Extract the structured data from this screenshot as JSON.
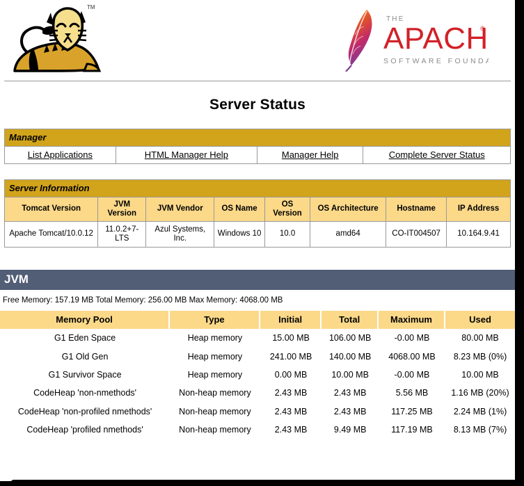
{
  "header": {
    "tomcat_logo_alt": "Apache Tomcat cat mascot logo",
    "tomcat_trademark": "TM",
    "apache_logo_the": "THE",
    "apache_logo_name": "APACHE",
    "apache_logo_registered": "®",
    "apache_logo_tagline": "SOFTWARE FOUNDATION"
  },
  "page_title": "Server Status",
  "manager": {
    "section_label": "Manager",
    "links": [
      {
        "label": "List Applications"
      },
      {
        "label": "HTML Manager Help"
      },
      {
        "label": "Manager Help"
      },
      {
        "label": "Complete Server Status"
      }
    ]
  },
  "server_information": {
    "section_label": "Server Information",
    "columns": [
      "Tomcat Version",
      "JVM Version",
      "JVM Vendor",
      "OS Name",
      "OS Version",
      "OS Architecture",
      "Hostname",
      "IP Address"
    ],
    "row": [
      "Apache Tomcat/10.0.12",
      "11.0.2+7-LTS",
      "Azul Systems, Inc.",
      "Windows 10",
      "10.0",
      "amd64",
      "CO-IT004507",
      "10.164.9.41"
    ]
  },
  "jvm": {
    "banner_label": "JVM",
    "memory_summary": "Free Memory: 157.19 MB Total Memory: 256.00 MB Max Memory: 4068.00 MB",
    "memory_pool_columns": [
      "Memory Pool",
      "Type",
      "Initial",
      "Total",
      "Maximum",
      "Used"
    ],
    "memory_pools": [
      {
        "name": "G1 Eden Space",
        "type": "Heap memory",
        "initial": "15.00 MB",
        "total": "106.00 MB",
        "maximum": "-0.00 MB",
        "used": "80.00 MB"
      },
      {
        "name": "G1 Old Gen",
        "type": "Heap memory",
        "initial": "241.00 MB",
        "total": "140.00 MB",
        "maximum": "4068.00 MB",
        "used": "8.23 MB (0%)"
      },
      {
        "name": "G1 Survivor Space",
        "type": "Heap memory",
        "initial": "0.00 MB",
        "total": "10.00 MB",
        "maximum": "-0.00 MB",
        "used": "10.00 MB"
      },
      {
        "name": "CodeHeap 'non-nmethods'",
        "type": "Non-heap memory",
        "initial": "2.43 MB",
        "total": "2.43 MB",
        "maximum": "5.56 MB",
        "used": "1.16 MB (20%)"
      },
      {
        "name": "CodeHeap 'non-profiled nmethods'",
        "type": "Non-heap memory",
        "initial": "2.43 MB",
        "total": "2.43 MB",
        "maximum": "117.25 MB",
        "used": "2.24 MB (1%)"
      },
      {
        "name": "CodeHeap 'profiled nmethods'",
        "type": "Non-heap memory",
        "initial": "2.43 MB",
        "total": "9.49 MB",
        "maximum": "117.19 MB",
        "used": "8.13 MB (7%)"
      }
    ]
  },
  "colors": {
    "section_header_gold": "#D2A41C",
    "column_header_gold": "#FBD989",
    "jvm_banner_slate": "#525D76",
    "border_gray": "#999999",
    "apache_red": "#D22128",
    "tomcat_gold": "#D9A32B",
    "tomcat_light": "#F5DE8C"
  }
}
